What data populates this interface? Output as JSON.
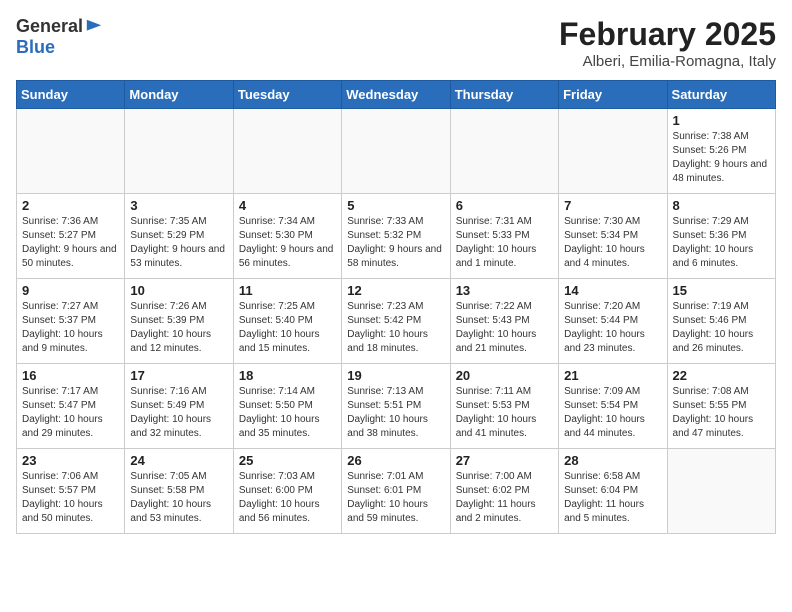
{
  "header": {
    "logo_general": "General",
    "logo_blue": "Blue",
    "month_title": "February 2025",
    "location": "Alberi, Emilia-Romagna, Italy"
  },
  "weekdays": [
    "Sunday",
    "Monday",
    "Tuesday",
    "Wednesday",
    "Thursday",
    "Friday",
    "Saturday"
  ],
  "weeks": [
    [
      {
        "day": "",
        "info": ""
      },
      {
        "day": "",
        "info": ""
      },
      {
        "day": "",
        "info": ""
      },
      {
        "day": "",
        "info": ""
      },
      {
        "day": "",
        "info": ""
      },
      {
        "day": "",
        "info": ""
      },
      {
        "day": "1",
        "info": "Sunrise: 7:38 AM\nSunset: 5:26 PM\nDaylight: 9 hours and 48 minutes."
      }
    ],
    [
      {
        "day": "2",
        "info": "Sunrise: 7:36 AM\nSunset: 5:27 PM\nDaylight: 9 hours and 50 minutes."
      },
      {
        "day": "3",
        "info": "Sunrise: 7:35 AM\nSunset: 5:29 PM\nDaylight: 9 hours and 53 minutes."
      },
      {
        "day": "4",
        "info": "Sunrise: 7:34 AM\nSunset: 5:30 PM\nDaylight: 9 hours and 56 minutes."
      },
      {
        "day": "5",
        "info": "Sunrise: 7:33 AM\nSunset: 5:32 PM\nDaylight: 9 hours and 58 minutes."
      },
      {
        "day": "6",
        "info": "Sunrise: 7:31 AM\nSunset: 5:33 PM\nDaylight: 10 hours and 1 minute."
      },
      {
        "day": "7",
        "info": "Sunrise: 7:30 AM\nSunset: 5:34 PM\nDaylight: 10 hours and 4 minutes."
      },
      {
        "day": "8",
        "info": "Sunrise: 7:29 AM\nSunset: 5:36 PM\nDaylight: 10 hours and 6 minutes."
      }
    ],
    [
      {
        "day": "9",
        "info": "Sunrise: 7:27 AM\nSunset: 5:37 PM\nDaylight: 10 hours and 9 minutes."
      },
      {
        "day": "10",
        "info": "Sunrise: 7:26 AM\nSunset: 5:39 PM\nDaylight: 10 hours and 12 minutes."
      },
      {
        "day": "11",
        "info": "Sunrise: 7:25 AM\nSunset: 5:40 PM\nDaylight: 10 hours and 15 minutes."
      },
      {
        "day": "12",
        "info": "Sunrise: 7:23 AM\nSunset: 5:42 PM\nDaylight: 10 hours and 18 minutes."
      },
      {
        "day": "13",
        "info": "Sunrise: 7:22 AM\nSunset: 5:43 PM\nDaylight: 10 hours and 21 minutes."
      },
      {
        "day": "14",
        "info": "Sunrise: 7:20 AM\nSunset: 5:44 PM\nDaylight: 10 hours and 23 minutes."
      },
      {
        "day": "15",
        "info": "Sunrise: 7:19 AM\nSunset: 5:46 PM\nDaylight: 10 hours and 26 minutes."
      }
    ],
    [
      {
        "day": "16",
        "info": "Sunrise: 7:17 AM\nSunset: 5:47 PM\nDaylight: 10 hours and 29 minutes."
      },
      {
        "day": "17",
        "info": "Sunrise: 7:16 AM\nSunset: 5:49 PM\nDaylight: 10 hours and 32 minutes."
      },
      {
        "day": "18",
        "info": "Sunrise: 7:14 AM\nSunset: 5:50 PM\nDaylight: 10 hours and 35 minutes."
      },
      {
        "day": "19",
        "info": "Sunrise: 7:13 AM\nSunset: 5:51 PM\nDaylight: 10 hours and 38 minutes."
      },
      {
        "day": "20",
        "info": "Sunrise: 7:11 AM\nSunset: 5:53 PM\nDaylight: 10 hours and 41 minutes."
      },
      {
        "day": "21",
        "info": "Sunrise: 7:09 AM\nSunset: 5:54 PM\nDaylight: 10 hours and 44 minutes."
      },
      {
        "day": "22",
        "info": "Sunrise: 7:08 AM\nSunset: 5:55 PM\nDaylight: 10 hours and 47 minutes."
      }
    ],
    [
      {
        "day": "23",
        "info": "Sunrise: 7:06 AM\nSunset: 5:57 PM\nDaylight: 10 hours and 50 minutes."
      },
      {
        "day": "24",
        "info": "Sunrise: 7:05 AM\nSunset: 5:58 PM\nDaylight: 10 hours and 53 minutes."
      },
      {
        "day": "25",
        "info": "Sunrise: 7:03 AM\nSunset: 6:00 PM\nDaylight: 10 hours and 56 minutes."
      },
      {
        "day": "26",
        "info": "Sunrise: 7:01 AM\nSunset: 6:01 PM\nDaylight: 10 hours and 59 minutes."
      },
      {
        "day": "27",
        "info": "Sunrise: 7:00 AM\nSunset: 6:02 PM\nDaylight: 11 hours and 2 minutes."
      },
      {
        "day": "28",
        "info": "Sunrise: 6:58 AM\nSunset: 6:04 PM\nDaylight: 11 hours and 5 minutes."
      },
      {
        "day": "",
        "info": ""
      }
    ]
  ]
}
